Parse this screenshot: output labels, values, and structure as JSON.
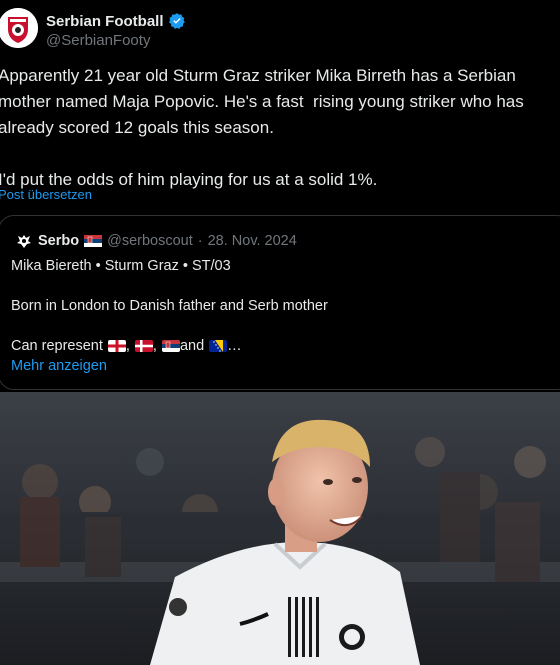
{
  "account": {
    "name": "Serbian Football",
    "handle": "@SerbianFooty"
  },
  "tweet": {
    "text": "Apparently 21 year old Sturm Graz striker Mika Birreth has a Serbian mother named Maja Popovic. He's a fast  rising young striker who has already scored 12 goals this season.\n\nI'd put the odds of him playing for us at a solid 1%.",
    "translate_label": "Post übersetzen"
  },
  "quote": {
    "name": "Serbo",
    "handle": "@serboscout",
    "separator": "·",
    "date": "28. Nov. 2024",
    "line1": "Mika Biereth • Sturm Graz • ST/03",
    "line2": "Born in London to Danish father and Serb mother",
    "line3_prefix": "Can represent",
    "comma": ",",
    "and_word": "and",
    "ellipsis": " …",
    "show_more": "Mehr anzeigen",
    "flags": [
      "england-flag",
      "denmark-flag",
      "serbia-flag",
      "bosnia-flag"
    ]
  },
  "colors": {
    "background": "#000000",
    "text": "#e7e9ea",
    "muted": "#71767b",
    "link": "#1d9bf0",
    "border": "#2f3336"
  }
}
